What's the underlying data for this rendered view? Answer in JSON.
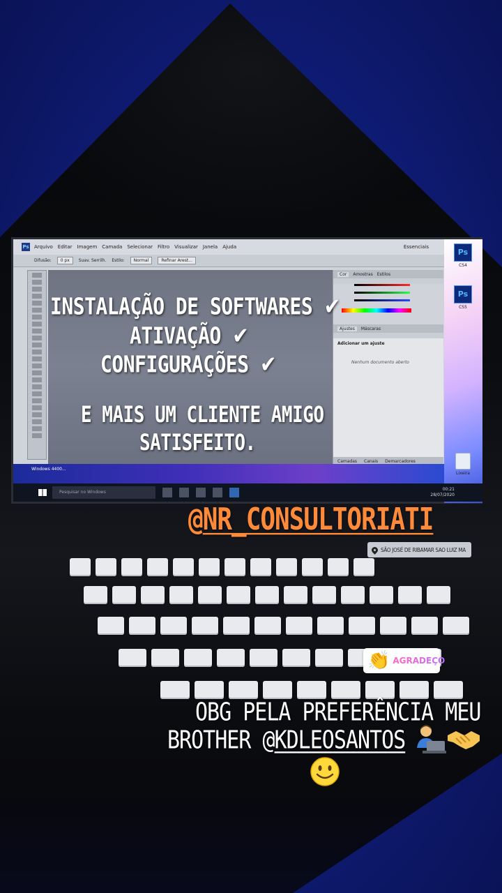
{
  "photoshop": {
    "menu": [
      "Arquivo",
      "Editar",
      "Imagem",
      "Camada",
      "Selecionar",
      "Filtro",
      "Visualizar",
      "Janela",
      "Ajuda"
    ],
    "workspace": "Essenciais",
    "options": {
      "feather_label": "Difusão:",
      "feather_value": "0 px",
      "antialias": "Suav. Serrilh.",
      "style_label": "Estilo:",
      "style_value": "Normal",
      "refine_button": "Refinar Arest..."
    },
    "panel_tabs": [
      "Cor",
      "Amostras",
      "Estilos"
    ],
    "adjust_tabs": [
      "Ajustes",
      "Máscaras"
    ],
    "adjust_header": "Adicionar um ajuste",
    "adjust_empty": "Nenhum documento aberto",
    "bottom_tabs": [
      "Camadas",
      "Canais",
      "Demarcadores"
    ]
  },
  "desktop": {
    "icons": [
      {
        "name": "Ps",
        "label": "CS4"
      },
      {
        "name": "Ps",
        "label": "CS5"
      },
      {
        "name": "bin",
        "label": "Lixeira"
      }
    ],
    "windows_label": "Windows 4400...",
    "taskbar": {
      "search_placeholder": "Pesquisar no Windows",
      "time": "00:21",
      "date": "28/07/2020"
    }
  },
  "story": {
    "lines": [
      "INSTALAÇÃO DE SOFTWARES",
      "ATIVAÇÃO",
      "CONFIGURAÇÕES",
      "E MAIS UM CLIENTE AMIGO",
      "SATISFEITO."
    ],
    "tick": "✔",
    "mention_at": "@",
    "mention_handle": "NR_CONSULTORIATI",
    "location": "SÃO JOSÉ DE RIBAMAR SAO LUIZ MA",
    "sticker_label": "AGRADEÇO",
    "thanks_line1": "OBG PELA PREFERÊNCIA MEU",
    "thanks_line2_prefix": "BROTHER @",
    "thanks_line2_handle": "KDLEOSANTOS",
    "emojis": [
      "person-laptop",
      "handshake",
      "smile"
    ]
  },
  "colors": {
    "frame_blue": "#0f1c76",
    "mention_orange": "#ff8a3a",
    "sticker_pink": "#ff6ac1"
  }
}
